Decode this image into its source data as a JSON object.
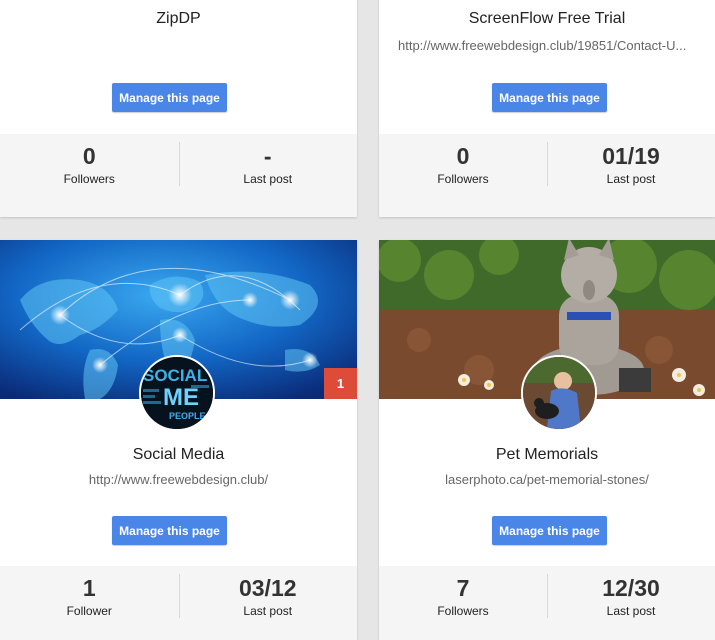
{
  "cards": [
    {
      "title": "ZipDP",
      "url": "",
      "button": "Manage this page",
      "stats": [
        {
          "value": "0",
          "label": "Followers"
        },
        {
          "value": "-",
          "label": "Last post"
        }
      ]
    },
    {
      "title": "ScreenFlow Free Trial",
      "url": "http://www.freewebdesign.club/19851/Contact-U...",
      "button": "Manage this page",
      "stats": [
        {
          "value": "0",
          "label": "Followers"
        },
        {
          "value": "01/19",
          "label": "Last post"
        }
      ]
    },
    {
      "title": "Social Media",
      "url": "http://www.freewebdesign.club/",
      "button": "Manage this page",
      "badge": "1",
      "avatar_text": [
        "SOCIAL",
        "ME",
        "PEOPLE"
      ],
      "stats": [
        {
          "value": "1",
          "label": "Follower"
        },
        {
          "value": "03/12",
          "label": "Last post"
        }
      ]
    },
    {
      "title": "Pet Memorials",
      "url": "laserphoto.ca/pet-memorial-stones/",
      "button": "Manage this page",
      "stats": [
        {
          "value": "7",
          "label": "Followers"
        },
        {
          "value": "12/30",
          "label": "Last post"
        }
      ]
    }
  ],
  "colors": {
    "button": "#4a86e8",
    "badge": "#dd4b39",
    "stats_bg": "#f5f5f5"
  }
}
